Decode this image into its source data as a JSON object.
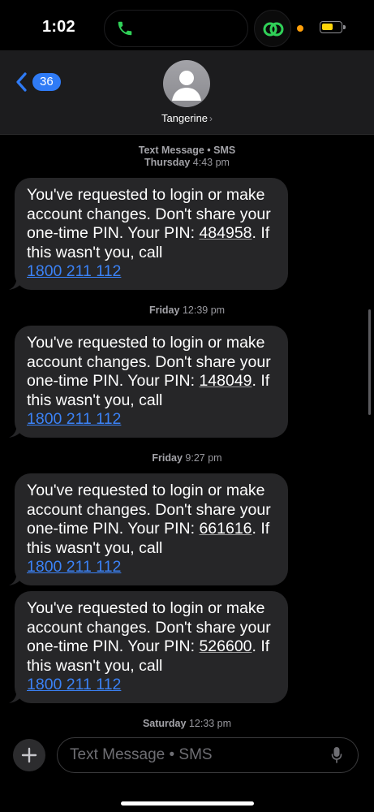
{
  "status_bar": {
    "time": "1:02",
    "icons": [
      "phone-icon",
      "link-icon",
      "battery-icon"
    ],
    "colors": {
      "call_green": "#30d158",
      "link_green": "#30d158",
      "privacy_dot": "#ff9f0a",
      "battery": "#ffd60a"
    }
  },
  "header": {
    "back_count": "36",
    "contact_name": "Tangerine",
    "contact_arrow": "›"
  },
  "thread": {
    "header_stamp": {
      "service": "Text Message • SMS",
      "day": "Thursday",
      "time": "4:43 pm"
    },
    "messages": [
      {
        "text_before": "You've requested to login or make account changes. Don't share your one-time PIN. Your PIN: ",
        "pin": "484958",
        "text_after": ". If this wasn't you, call ",
        "phone": "1800 211 112"
      },
      {
        "text_before": "You've requested to login or make account changes. Don't share your one-time PIN. Your PIN: ",
        "pin": "148049",
        "text_after": ". If this wasn't you, call ",
        "phone": "1800 211 112"
      },
      {
        "text_before": "You've requested to login or make account changes. Don't share your one-time PIN. Your PIN: ",
        "pin": "661616",
        "text_after": ". If this wasn't you, call ",
        "phone": "1800 211 112"
      },
      {
        "text_before": "You've requested to login or make account changes. Don't share your one-time PIN. Your PIN: ",
        "pin": "526600",
        "text_after": ". If this wasn't you, call ",
        "phone": "1800 211 112"
      }
    ],
    "stamps": [
      {
        "day": "Friday",
        "time": "12:39 pm"
      },
      {
        "day": "Friday",
        "time": "9:27 pm"
      },
      {
        "day": "Saturday",
        "time": "12:33 pm"
      }
    ],
    "colors": {
      "bubble": "#262628",
      "link": "#3b82f6"
    }
  },
  "input": {
    "placeholder": "Text Message • SMS",
    "icons": [
      "plus-icon",
      "mic-icon"
    ]
  }
}
